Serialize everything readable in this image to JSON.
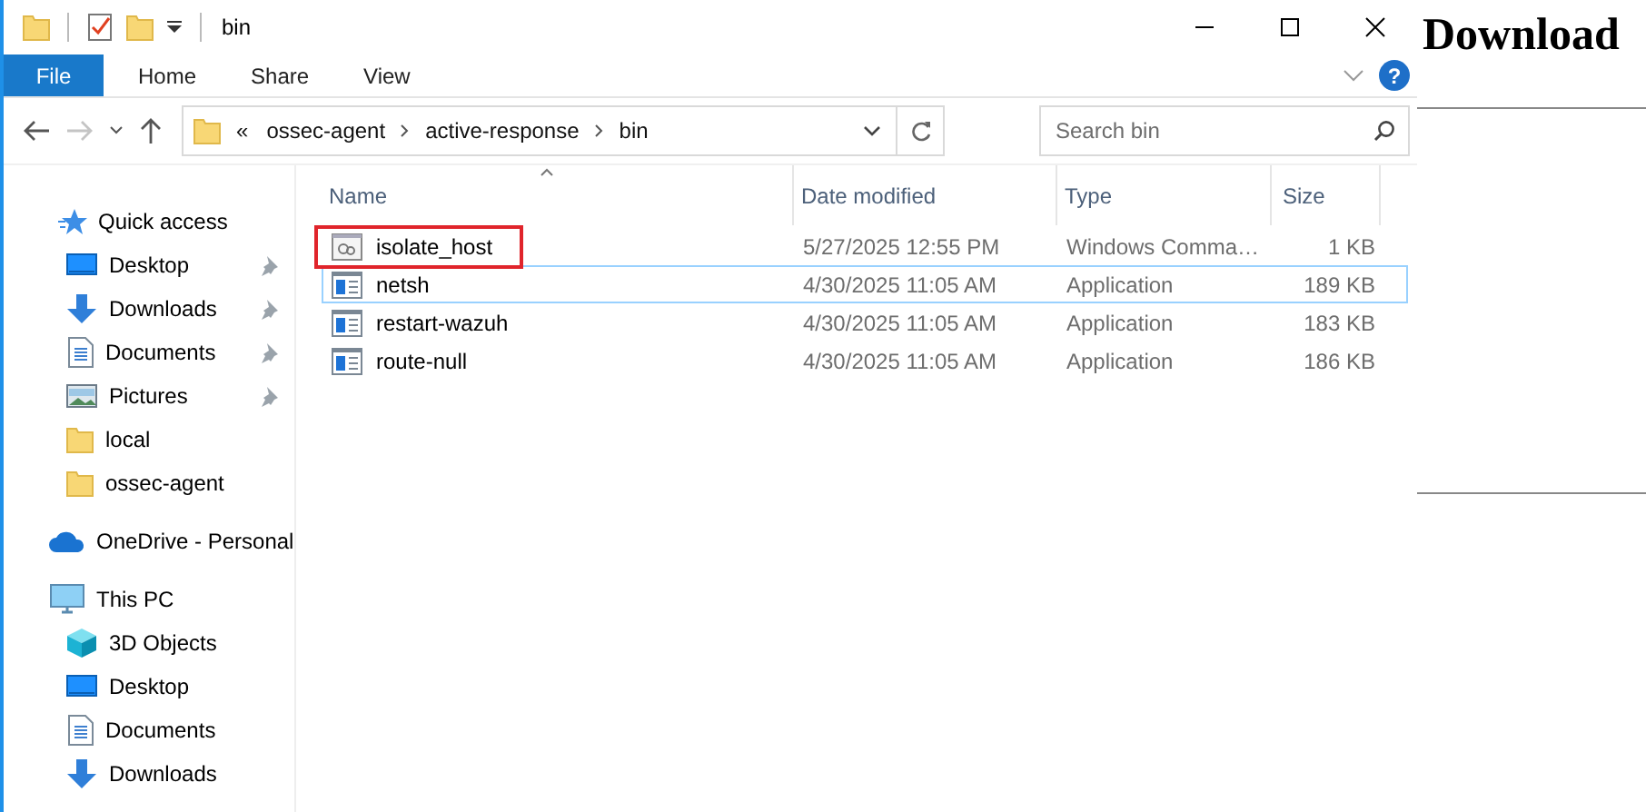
{
  "window": {
    "title": "bin"
  },
  "ribbon": {
    "tabs": [
      {
        "label": "File",
        "kind": "file-menu"
      },
      {
        "label": "Home",
        "kind": "tab"
      },
      {
        "label": "Share",
        "kind": "tab"
      },
      {
        "label": "View",
        "kind": "tab"
      }
    ],
    "help": "?"
  },
  "navigation": {
    "back": {
      "disabled": false
    },
    "forward": {
      "disabled": true
    }
  },
  "address": {
    "overflow": "«",
    "segments": [
      "ossec-agent",
      "active-response",
      "bin"
    ]
  },
  "search": {
    "placeholder": "Search bin"
  },
  "sidebar": {
    "items": [
      {
        "label": "Quick access",
        "kind": "star",
        "children": [
          {
            "label": "Desktop",
            "kind": "desktop",
            "pinned": true
          },
          {
            "label": "Downloads",
            "kind": "download",
            "pinned": true
          },
          {
            "label": "Documents",
            "kind": "document",
            "pinned": true
          },
          {
            "label": "Pictures",
            "kind": "picture",
            "pinned": true
          },
          {
            "label": "local",
            "kind": "folder",
            "pinned": false
          },
          {
            "label": "ossec-agent",
            "kind": "folder",
            "pinned": false
          }
        ]
      },
      {
        "label": "OneDrive - Personal",
        "kind": "cloud"
      },
      {
        "label": "This PC",
        "kind": "computer",
        "children": [
          {
            "label": "3D Objects",
            "kind": "cube"
          },
          {
            "label": "Desktop",
            "kind": "desktop"
          },
          {
            "label": "Documents",
            "kind": "document"
          },
          {
            "label": "Downloads",
            "kind": "download"
          }
        ]
      }
    ]
  },
  "file_list": {
    "columns": [
      {
        "label": "Name",
        "sorted": true
      },
      {
        "label": "Date modified"
      },
      {
        "label": "Type"
      },
      {
        "label": "Size"
      }
    ],
    "rows": [
      {
        "name": "isolate_host",
        "kind": "script",
        "date_modified": "5/27/2025 12:55 PM",
        "type": "Windows Comma…",
        "size": "1 KB",
        "highlighted": true,
        "focused": false
      },
      {
        "name": "netsh",
        "kind": "application",
        "date_modified": "4/30/2025 11:05 AM",
        "type": "Application",
        "size": "189 KB",
        "highlighted": false,
        "focused": true
      },
      {
        "name": "restart-wazuh",
        "kind": "application",
        "date_modified": "4/30/2025 11:05 AM",
        "type": "Application",
        "size": "183 KB",
        "highlighted": false,
        "focused": false
      },
      {
        "name": "route-null",
        "kind": "application",
        "date_modified": "4/30/2025 11:05 AM",
        "type": "Application",
        "size": "186 KB",
        "highlighted": false,
        "focused": false
      }
    ]
  },
  "backdrop": {
    "heading": "Download"
  }
}
